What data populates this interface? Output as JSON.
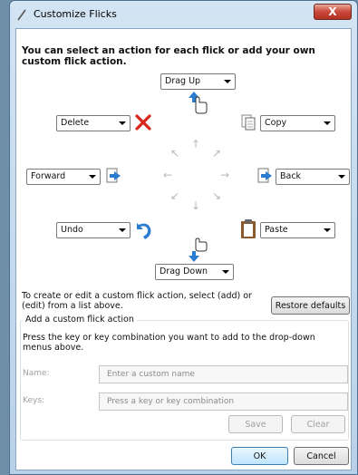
{
  "window": {
    "title": "Customize Flicks",
    "close_label": "X"
  },
  "heading": "You can select an action for each flick or add your own custom flick action.",
  "flicks": {
    "up": "Drag Up",
    "down": "Drag Down",
    "up_left": "Delete",
    "up_right": "Copy",
    "left": "Forward",
    "right": "Back",
    "down_left": "Undo",
    "down_right": "Paste"
  },
  "guides": {
    "n": "↑",
    "s": "↓",
    "e": "→",
    "w": "←",
    "ne": "↗",
    "nw": "↖",
    "se": "↘",
    "sw": "↙"
  },
  "instructions": "To create or edit a custom flick action, select (add) or (edit) from a list above.",
  "restore_label": "Restore defaults",
  "custom": {
    "legend": "Add a custom flick action",
    "description": "Press the key or key combination you want to add to the drop-down menus above.",
    "name_label": "Name:",
    "name_placeholder": "Enter a custom name",
    "keys_label": "Keys:",
    "keys_placeholder": "Press a key or key combination",
    "save_label": "Save",
    "clear_label": "Clear"
  },
  "footer": {
    "ok_label": "OK",
    "cancel_label": "Cancel"
  },
  "icons": {
    "up": "hand-drag-up-icon",
    "down": "hand-drag-down-icon",
    "delete": "delete-x-icon",
    "copy": "copy-icon",
    "forward": "forward-icon",
    "back": "back-icon",
    "undo": "undo-icon",
    "paste": "paste-icon"
  },
  "colors": {
    "accent": "#3c7fb1",
    "delete_red": "#d9261c",
    "arrow_blue": "#2a7dd1",
    "paste_brown": "#8a5a2b"
  }
}
